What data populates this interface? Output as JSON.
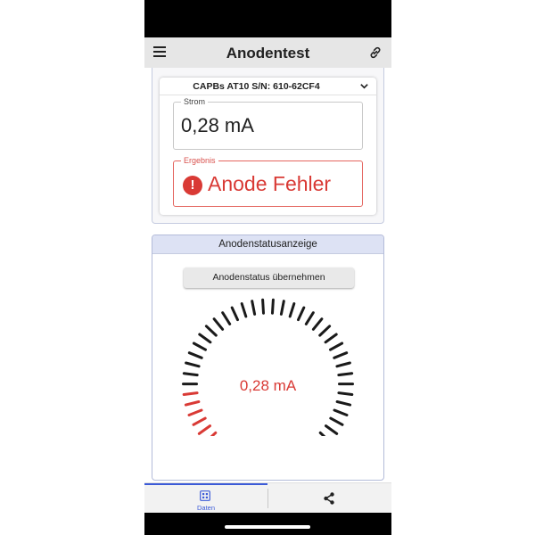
{
  "app": {
    "title": "Anodentest"
  },
  "header": {
    "menu_icon": "hamburger-menu-icon",
    "link_icon": "link-icon"
  },
  "device": {
    "selected": "CAPBs AT10 S/N: 610-62CF4"
  },
  "measurement": {
    "strom_label": "Strom",
    "strom_value": "0,28 mA",
    "ergebnis_label": "Ergebnis",
    "ergebnis_value": "Anode Fehler"
  },
  "status_panel": {
    "title": "Anodenstatusanzeige",
    "button_label": "Anodenstatus übernehmen",
    "gauge_value_text": "0,28 mA",
    "gauge_active_fraction": 0.18
  },
  "bottom_nav": {
    "data_label": "Daten",
    "data_icon": "grid-icon",
    "share_icon": "share-icon"
  },
  "colors": {
    "error": "#d93a35",
    "accent": "#3c5bd8",
    "panel_header": "#dde2f4",
    "gauge_inactive": "#1a1a1a"
  }
}
